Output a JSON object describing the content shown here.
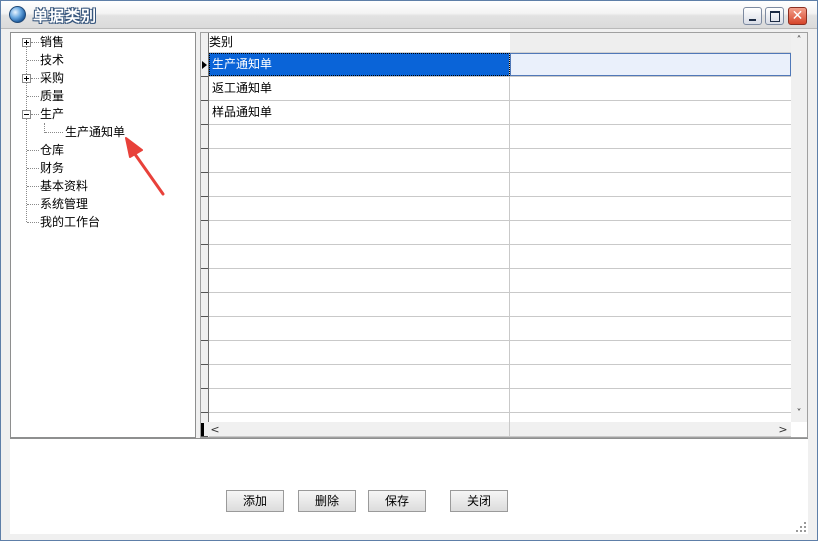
{
  "window": {
    "title": "单据类别"
  },
  "tree": {
    "items": [
      {
        "label": "销售",
        "expander": "+"
      },
      {
        "label": "技术",
        "expander": ""
      },
      {
        "label": "采购",
        "expander": "+"
      },
      {
        "label": "质量",
        "expander": ""
      },
      {
        "label": "生产",
        "expander": "-"
      },
      {
        "label": "生产通知单",
        "expander": "",
        "child": true
      },
      {
        "label": "仓库",
        "expander": ""
      },
      {
        "label": "财务",
        "expander": ""
      },
      {
        "label": "基本资料",
        "expander": ""
      },
      {
        "label": "系统管理",
        "expander": ""
      },
      {
        "label": "我的工作台",
        "expander": ""
      }
    ]
  },
  "grid": {
    "column_header": "类别",
    "rows": [
      "生产通知单",
      "返工通知单",
      "样品通知单",
      "",
      "",
      "",
      "",
      "",
      "",
      "",
      "",
      "",
      "",
      "",
      "",
      ""
    ],
    "selected_row": 0
  },
  "buttons": {
    "add": "添加",
    "delete": "删除",
    "save": "保存",
    "close": "关闭"
  },
  "colors": {
    "selection": "#0a64d8",
    "arrow": "#e8413a",
    "title_border": "#36557c"
  }
}
